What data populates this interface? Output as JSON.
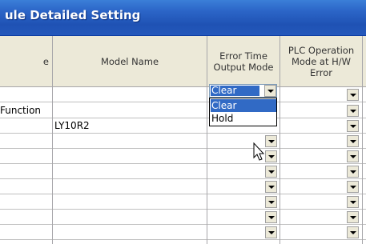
{
  "window": {
    "title": "ule Detailed Setting"
  },
  "grid": {
    "headers": [
      "e",
      "Model Name",
      "Error Time\nOutput Mode",
      "PLC Operation\nMode at H/W\nError"
    ],
    "rows": [
      {
        "col0": "",
        "model": ""
      },
      {
        "col0": "Function",
        "model": ""
      },
      {
        "col0": "",
        "model": "LY10R2"
      },
      {
        "col0": "",
        "model": ""
      },
      {
        "col0": "",
        "model": ""
      },
      {
        "col0": "",
        "model": ""
      },
      {
        "col0": "",
        "model": ""
      },
      {
        "col0": "",
        "model": ""
      },
      {
        "col0": "",
        "model": ""
      },
      {
        "col0": "",
        "model": ""
      }
    ]
  },
  "combo": {
    "value": "Clear",
    "options": [
      "Clear",
      "Hold"
    ],
    "highlighted": "Clear"
  },
  "icons": {
    "dropdown": "chevron-down-icon",
    "cursor": "arrow-cursor-icon"
  },
  "colors": {
    "title_bar": "#2458bb",
    "selection": "#316ac5",
    "header_bg": "#ece9d8"
  }
}
